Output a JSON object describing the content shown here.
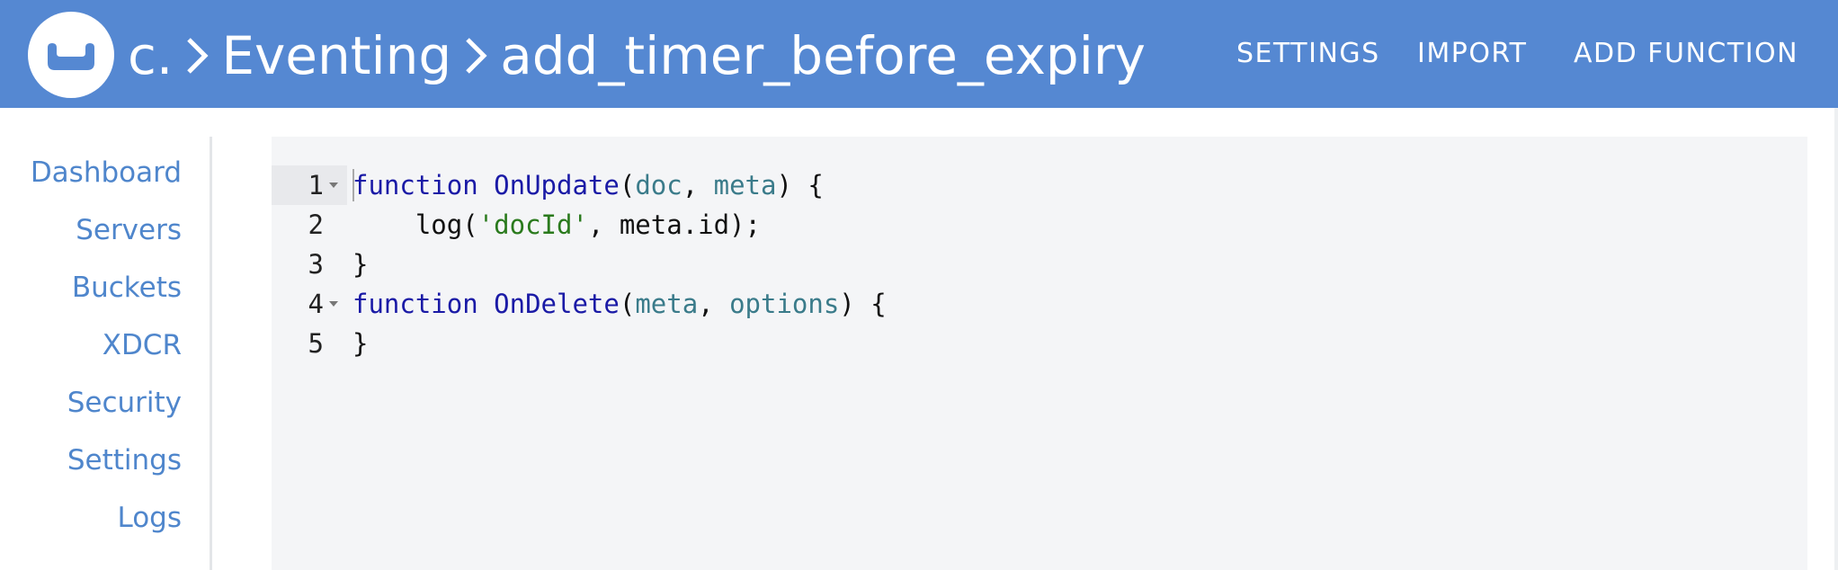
{
  "header": {
    "breadcrumb": [
      "c.",
      "Eventing",
      "add_timer_before_expiry"
    ],
    "nav": [
      "SETTINGS",
      "IMPORT",
      "ADD FUNCTION"
    ],
    "colors": {
      "background": "#5588d2",
      "text": "#ffffff"
    },
    "icons": {
      "logo": "couchbase-logo-icon",
      "separator": "chevron-right-icon"
    }
  },
  "sidebar": {
    "items": [
      "Dashboard",
      "Servers",
      "Buckets",
      "XDCR",
      "Security",
      "Settings",
      "Logs"
    ],
    "color": "#4f86cc"
  },
  "editor": {
    "line_numbers": [
      "1",
      "2",
      "3",
      "4",
      "5"
    ],
    "lines": [
      [
        {
          "t": "function",
          "c": "kw"
        },
        {
          "t": " ",
          "c": "plain"
        },
        {
          "t": "OnUpdate",
          "c": "fn"
        },
        {
          "t": "(",
          "c": "plain"
        },
        {
          "t": "doc",
          "c": "param"
        },
        {
          "t": ", ",
          "c": "plain"
        },
        {
          "t": "meta",
          "c": "param"
        },
        {
          "t": ") {",
          "c": "plain"
        }
      ],
      [
        {
          "t": "    log(",
          "c": "plain"
        },
        {
          "t": "'docId'",
          "c": "str"
        },
        {
          "t": ", meta.id);",
          "c": "plain"
        }
      ],
      [
        {
          "t": "}",
          "c": "plain"
        }
      ],
      [
        {
          "t": "function",
          "c": "kw"
        },
        {
          "t": " ",
          "c": "plain"
        },
        {
          "t": "OnDelete",
          "c": "fn"
        },
        {
          "t": "(",
          "c": "plain"
        },
        {
          "t": "meta",
          "c": "param"
        },
        {
          "t": ", ",
          "c": "plain"
        },
        {
          "t": "options",
          "c": "param"
        },
        {
          "t": ") {",
          "c": "plain"
        }
      ],
      [
        {
          "t": "}",
          "c": "plain"
        }
      ]
    ],
    "foldable_lines": [
      "1",
      "4"
    ],
    "active_line": "1",
    "colors": {
      "background": "#f4f5f7",
      "keyword": "#1a1aa6",
      "param": "#3a7b8a",
      "string": "#2a7a1d"
    }
  }
}
